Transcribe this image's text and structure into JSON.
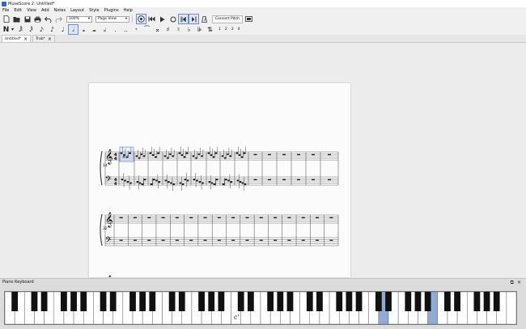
{
  "window": {
    "title": "MuseScore 2: Untitled*"
  },
  "menu": [
    "File",
    "Edit",
    "View",
    "Add",
    "Notes",
    "Layout",
    "Style",
    "Plugins",
    "Help"
  ],
  "toolbar": {
    "zoom": "100%",
    "view_mode": "Page View",
    "concert_pitch": "Concert Pitch",
    "file_icons": [
      "new-file-icon",
      "open-file-icon",
      "save-icon",
      "print-icon",
      "undo-icon",
      "redo-icon"
    ]
  },
  "note_input": {
    "voices": [
      "1",
      "2",
      "3",
      "4"
    ]
  },
  "tabs": [
    {
      "label": "Untitled*",
      "active": true
    },
    {
      "label": "Trab*",
      "active": false
    }
  ],
  "score": {
    "measure_numbers": [
      "14",
      "32"
    ]
  },
  "piano": {
    "title": "Piano Keyboard",
    "c_label": "c'",
    "highlighted_keys": [
      38,
      43
    ]
  },
  "colors": {
    "selection": "#4a7bd4",
    "key_highlight": "#90abd6"
  }
}
